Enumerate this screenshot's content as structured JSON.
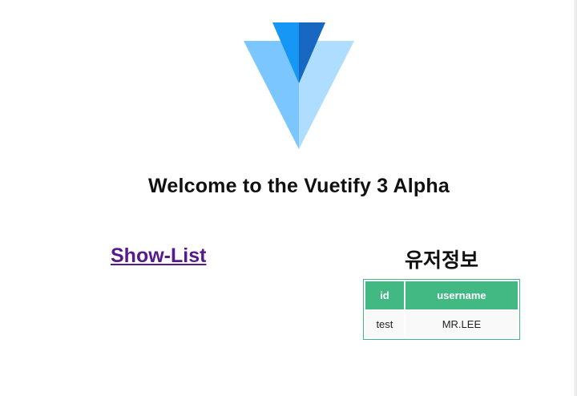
{
  "header": {
    "logo": "vuetify-logo",
    "logo_colors": [
      "#1697f6",
      "#1867c0",
      "#7bc6ff",
      "#aeddff"
    ],
    "welcome": "Welcome to the Vuetify 3 Alpha"
  },
  "nav": {
    "show_list": "Show-List"
  },
  "users": {
    "title": "유저정보",
    "columns": [
      "id",
      "username"
    ],
    "rows": [
      [
        "test",
        "MR.LEE"
      ]
    ],
    "accent": "#42b983"
  }
}
